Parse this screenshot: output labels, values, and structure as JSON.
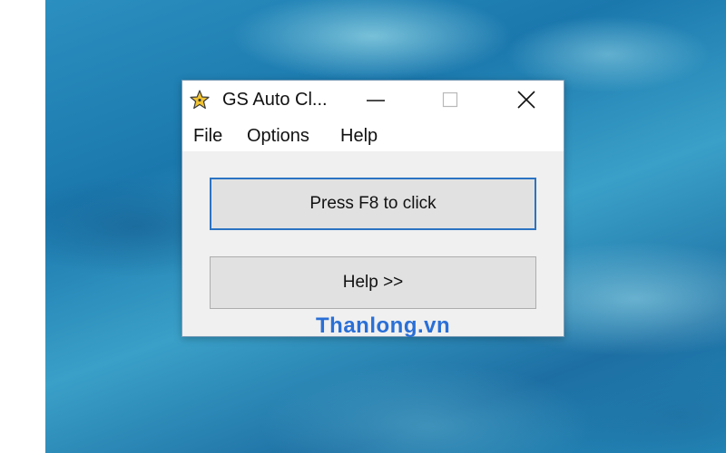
{
  "window": {
    "title": "GS Auto Cl...",
    "icon": "star-icon"
  },
  "menu": {
    "items": [
      {
        "label": "File"
      },
      {
        "label": "Options"
      },
      {
        "label": "Help"
      }
    ]
  },
  "main": {
    "primary_button_label": "Press F8 to click",
    "help_button_label": "Help >>"
  },
  "watermark": {
    "text": "Thanlong.vn"
  },
  "colors": {
    "focus_border": "#2b73c2",
    "watermark": "#2a6fd6",
    "star_fill": "#f2c433"
  }
}
